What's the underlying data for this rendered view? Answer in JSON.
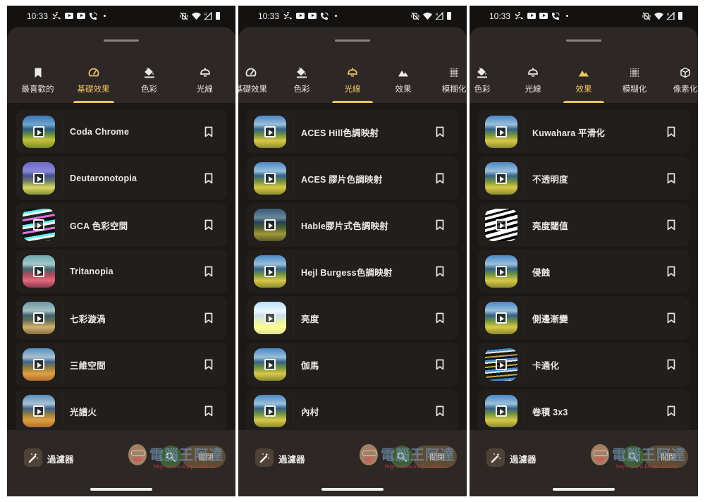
{
  "status_bar": {
    "time": "10:33",
    "left_icons": [
      "missed-call-icon",
      "youtube-icon",
      "youtube-icon",
      "wifi-calling-icon",
      "notification-dot-icon"
    ],
    "right_icons": [
      "vibrate-off-icon",
      "wifi-icon",
      "signal-icon",
      "battery-icon"
    ]
  },
  "colors": {
    "accent": "#f0c060",
    "sheet_bg": "#2d2825",
    "list_bg": "#1b1816",
    "item_bg": "#211e1c",
    "search_fab": "#3f5e36",
    "close_button": "#5e4c35"
  },
  "panels": [
    {
      "tabs": [
        {
          "label": "最喜歡的",
          "icon": "bookmark-filled-icon",
          "active": false
        },
        {
          "label": "基礎效果",
          "icon": "speedometer-icon",
          "active": true
        },
        {
          "label": "色彩",
          "icon": "paint-bucket-icon",
          "active": false
        },
        {
          "label": "光線",
          "icon": "ceiling-lamp-icon",
          "active": false
        }
      ],
      "items": [
        {
          "label": "Coda Chrome",
          "thumb": "coda"
        },
        {
          "label": "Deutaronotopia",
          "thumb": "deut"
        },
        {
          "label": "GCA 色彩空間",
          "thumb": "gca"
        },
        {
          "label": "Tritanopia",
          "thumb": "trit"
        },
        {
          "label": "七彩漩渦",
          "thumb": "swirl"
        },
        {
          "label": "三維空間",
          "thumb": "warm"
        },
        {
          "label": "光譜火",
          "thumb": "warm"
        }
      ]
    },
    {
      "tabs": [
        {
          "label": "基礎效果",
          "icon": "speedometer-icon",
          "active": false
        },
        {
          "label": "色彩",
          "icon": "paint-bucket-icon",
          "active": false
        },
        {
          "label": "光線",
          "icon": "ceiling-lamp-icon",
          "active": true
        },
        {
          "label": "效果",
          "icon": "mountain-icon",
          "active": false
        },
        {
          "label": "模糊化",
          "icon": "dot-grid-icon",
          "active": false
        }
      ],
      "items": [
        {
          "label": "ACES Hill色調映射",
          "thumb": "normal"
        },
        {
          "label": "ACES 膠片色調映射",
          "thumb": "normal"
        },
        {
          "label": "Hable膠片式色調映射",
          "thumb": "dark"
        },
        {
          "label": "Hejl Burgess色調映射",
          "thumb": "normal"
        },
        {
          "label": "亮度",
          "thumb": "bright"
        },
        {
          "label": "伽馬",
          "thumb": "normal"
        },
        {
          "label": "內村",
          "thumb": "normal"
        }
      ]
    },
    {
      "tabs": [
        {
          "label": "色彩",
          "icon": "paint-bucket-icon",
          "active": false
        },
        {
          "label": "光線",
          "icon": "ceiling-lamp-icon",
          "active": false
        },
        {
          "label": "效果",
          "icon": "mountain-icon",
          "active": true
        },
        {
          "label": "模糊化",
          "icon": "dot-grid-icon",
          "active": false
        },
        {
          "label": "像素化",
          "icon": "cube-icon",
          "active": false
        }
      ],
      "items": [
        {
          "label": "Kuwahara 平滑化",
          "thumb": "normal"
        },
        {
          "label": "不透明度",
          "thumb": "normal"
        },
        {
          "label": "亮度閾值",
          "thumb": "bw"
        },
        {
          "label": "侵蝕",
          "thumb": "normal"
        },
        {
          "label": "側邊漸變",
          "thumb": "normal"
        },
        {
          "label": "卡通化",
          "thumb": "cartoon"
        },
        {
          "label": "卷積 3x3",
          "thumb": "normal"
        }
      ]
    }
  ],
  "bottom_bar": {
    "filter_label": "過濾器",
    "filter_icon": "magic-wand-icon",
    "search_icon": "search-icon",
    "close_label": "關閉"
  },
  "watermark": {
    "title": "電腦王阿達",
    "url": "http://www.kocpc.com.tw"
  }
}
